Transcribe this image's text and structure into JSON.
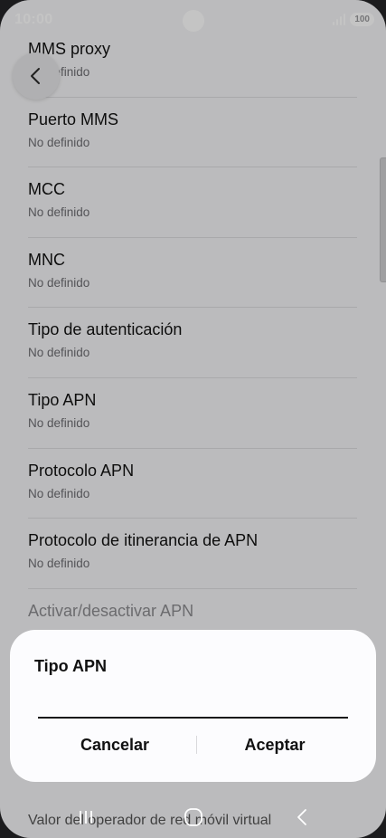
{
  "status_bar": {
    "time": "10:00",
    "battery": "100"
  },
  "settings": {
    "items": [
      {
        "title": "MMS proxy",
        "subtitle": "No definido"
      },
      {
        "title": "Puerto MMS",
        "subtitle": "No definido"
      },
      {
        "title": "MCC",
        "subtitle": "No definido"
      },
      {
        "title": "MNC",
        "subtitle": "No definido"
      },
      {
        "title": "Tipo de autenticación",
        "subtitle": "No definido"
      },
      {
        "title": "Tipo APN",
        "subtitle": "No definido"
      },
      {
        "title": "Protocolo APN",
        "subtitle": "No definido"
      },
      {
        "title": "Protocolo de itinerancia de APN",
        "subtitle": "No definido"
      }
    ],
    "toggle_item": {
      "title": "Activar/desactivar APN",
      "enabled": true
    },
    "trailing_text": "Valor del operador de red móvil virtual"
  },
  "dialog": {
    "title": "Tipo APN",
    "input_value": "",
    "cancel_label": "Cancelar",
    "accept_label": "Aceptar"
  },
  "icons": {
    "back": "back-arrow-icon",
    "nav_recents": "recent-apps-icon",
    "nav_home": "home-icon",
    "nav_back": "back-icon"
  },
  "colors": {
    "accent": "#3e72e6",
    "background": "#f4f4f6",
    "dialog": "#fcfcfe"
  }
}
